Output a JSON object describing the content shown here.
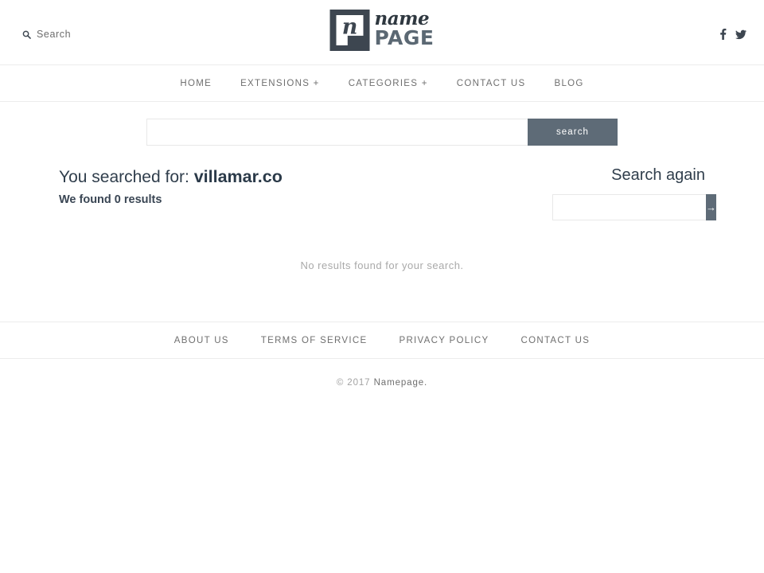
{
  "header": {
    "search_toggle": {
      "label": "Search",
      "icon": "search-icon"
    },
    "logo": {
      "mark_letter": "n",
      "word_top": "name",
      "word_bottom": "PAGE",
      "mark_color": "#3d4650",
      "word_bottom_color": "#5b6873"
    },
    "social": [
      {
        "name": "facebook",
        "icon": "facebook-icon"
      },
      {
        "name": "twitter",
        "icon": "twitter-icon"
      }
    ]
  },
  "nav": {
    "items": [
      {
        "label": "HOME"
      },
      {
        "label": "EXTENSIONS +"
      },
      {
        "label": "CATEGORIES +"
      },
      {
        "label": "CONTACT US"
      },
      {
        "label": "BLOG"
      }
    ]
  },
  "hero_search": {
    "input_value": "",
    "input_placeholder": "",
    "button_label": "search",
    "button_color": "#5e6b77"
  },
  "results": {
    "title_prefix": "You searched for:",
    "query_term": "villamar.co",
    "count_text": "We found 0 results",
    "empty_message": "No results found for your search."
  },
  "search_again": {
    "title": "Search again",
    "input_value": "",
    "input_placeholder": "",
    "button_label": "→"
  },
  "footer": {
    "links": [
      {
        "label": "ABOUT US"
      },
      {
        "label": "TERMS OF SERVICE"
      },
      {
        "label": "PRIVACY POLICY"
      },
      {
        "label": "CONTACT US"
      }
    ],
    "copyright_prefix": "© 2017",
    "copyright_brand": "Namepage."
  }
}
